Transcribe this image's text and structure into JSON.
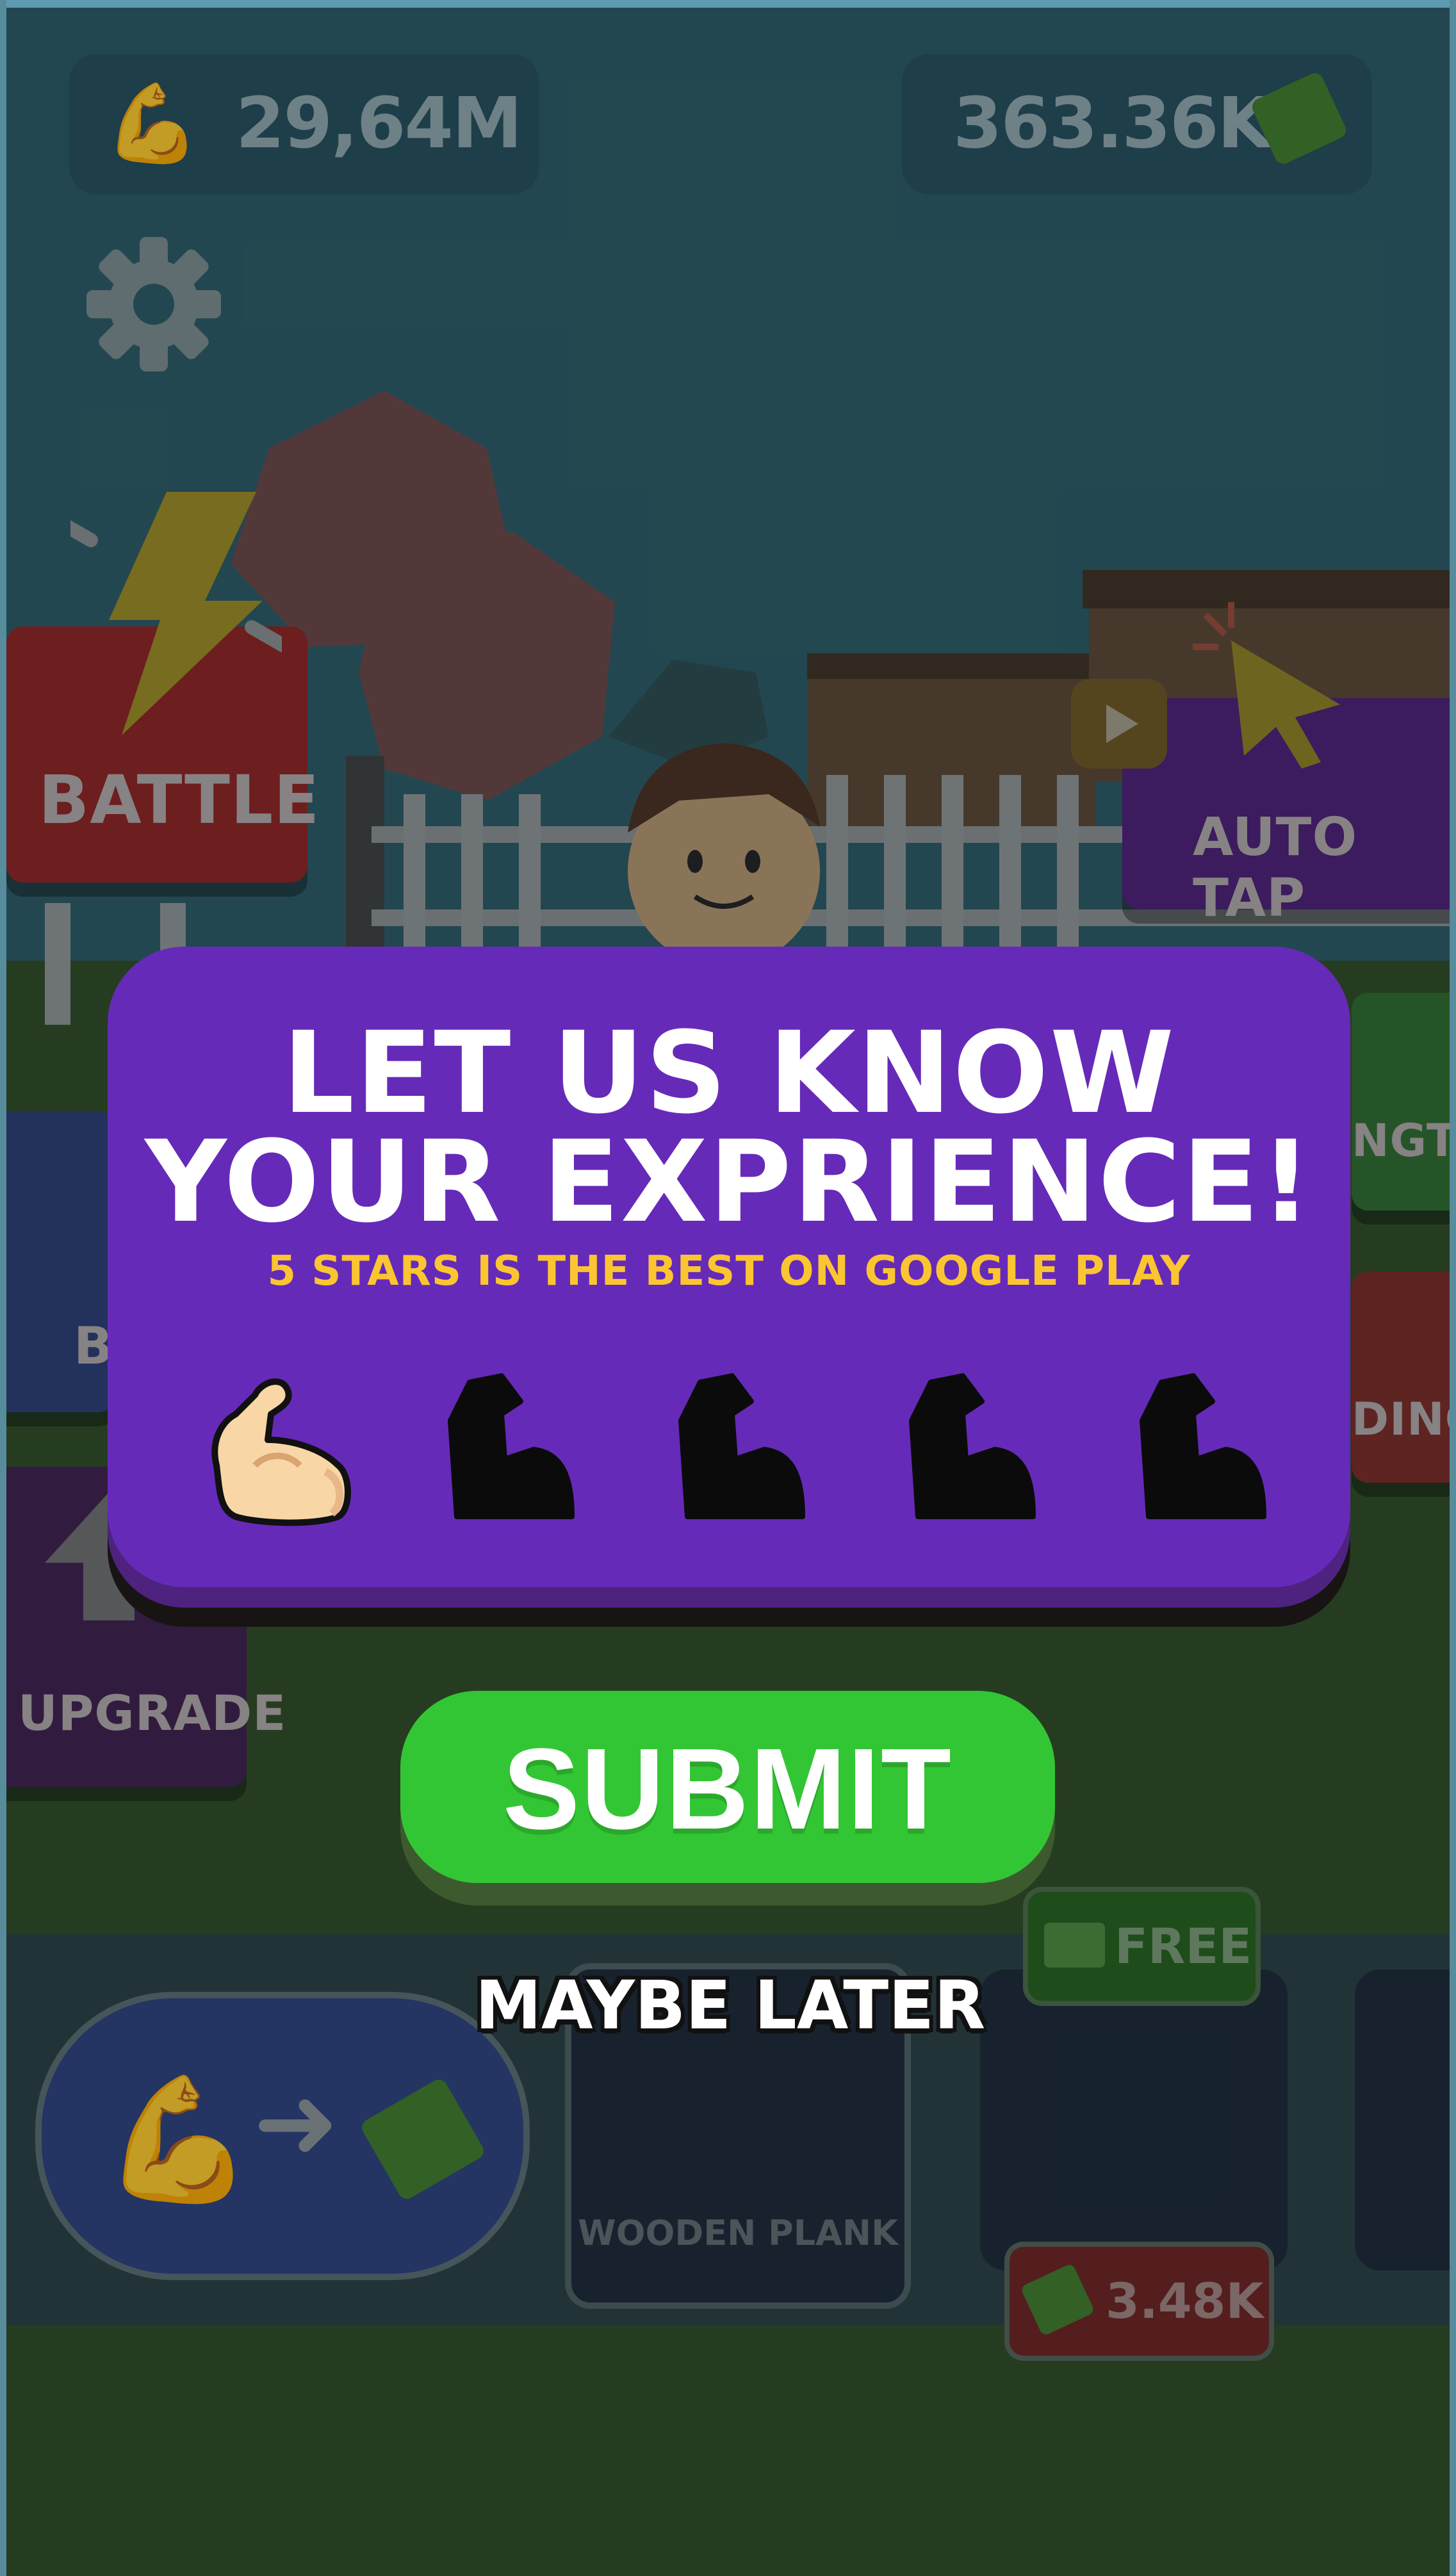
{
  "hud": {
    "strength_value": "29,64M",
    "cash_value": "363.36K"
  },
  "side_buttons": {
    "battle_label": "BATTLE",
    "auto_tap_label": "AUTO TAP",
    "strength_label": "NGTH",
    "building_label": "DING",
    "upgrade_label": "UPGRADE",
    "left_partial_label": "B"
  },
  "shop": {
    "free_label": "FREE",
    "item_name": "WOODEN PLANK",
    "price": "3.48K"
  },
  "modal": {
    "title_line1": "LET US KNOW",
    "title_line2": "YOUR EXPRIENCE!",
    "subtitle": "5 STARS IS THE BEST ON GOOGLE PLAY",
    "rating_selected": 1,
    "rating_max": 5,
    "rating_icon": "flexed-biceps-icon"
  },
  "buttons": {
    "submit_label": "SUBMIT",
    "maybe_later_label": "MAYBE LATER"
  },
  "colors": {
    "modal": "#662ab9",
    "subtitle": "#fbc531",
    "submit": "#33c634",
    "active_icon": "#f8d6a6"
  }
}
